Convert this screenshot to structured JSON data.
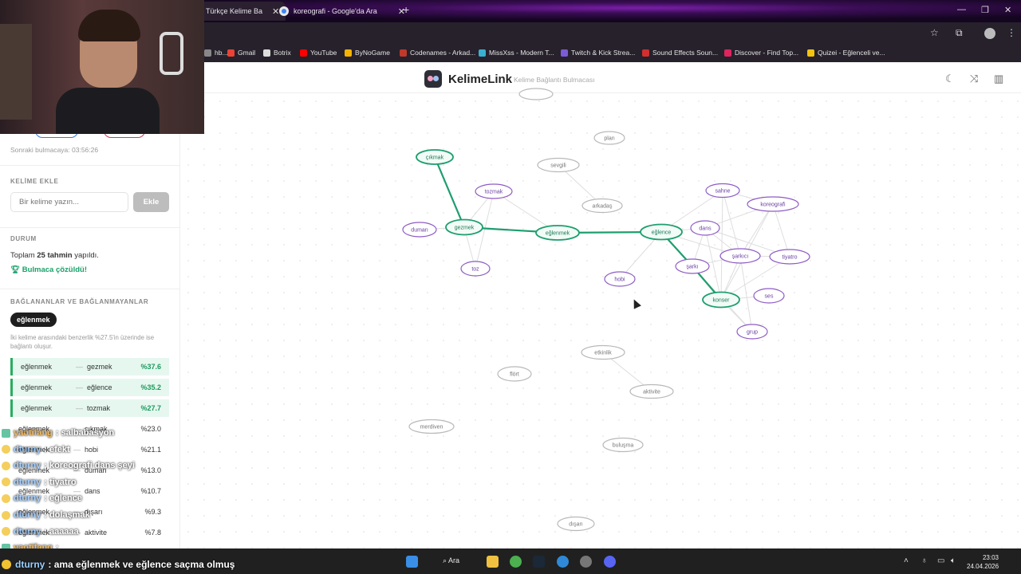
{
  "browser": {
    "tabs": [
      {
        "label": "Türkçe Kelime Ba",
        "active": true
      },
      {
        "label": "koreografi - Google'da Ara",
        "active": false
      }
    ],
    "bookmarks": [
      {
        "label": "hb...",
        "color": "#888888"
      },
      {
        "label": "Gmail",
        "color": "#ea4335"
      },
      {
        "label": "Botrix",
        "color": "#dddddd"
      },
      {
        "label": "YouTube",
        "color": "#ff0000"
      },
      {
        "label": "ByNoGame",
        "color": "#f5b400"
      },
      {
        "label": "Codenames - Arkad...",
        "color": "#c0392b"
      },
      {
        "label": "MissXss - Modern T...",
        "color": "#3ab0d0"
      },
      {
        "label": "Twitch & Kick Strea...",
        "color": "#7d5bd6"
      },
      {
        "label": "Sound Effects Soun...",
        "color": "#d32f2f"
      },
      {
        "label": "Discover - Find Top...",
        "color": "#e0245e"
      },
      {
        "label": "Quizei - Eğlenceli ve...",
        "color": "#f1c40f"
      }
    ]
  },
  "header": {
    "brand": "KelimeLink",
    "subtitle": "Kelime Bağlantı Bulmacası",
    "icons": [
      "moon-icon",
      "shuffle-icon",
      "stats-icon"
    ]
  },
  "sidebar": {
    "next_puzzle": "Sonraki bulmacaya: 03:56:26",
    "add_word_title": "KELİME EKLE",
    "input_placeholder": "Bir kelime yazın...",
    "add_button": "Ekle",
    "status_title": "DURUM",
    "total_prefix": "Toplam",
    "total_count": "25 tahmin",
    "total_suffix": "yapıldı.",
    "solved_text": "Bulmaca çözüldü!",
    "connections_title": "BAĞLANANLAR VE BAĞLANMAYANLAR",
    "selected_word": "eğlenmek",
    "hint": "İki kelime arasındaki benzerlik %27.5'in üzerinde ise bağlantı oluşur.",
    "rows": [
      {
        "a": "eğlenmek",
        "b": "gezmek",
        "pct": "%37.6",
        "connected": true
      },
      {
        "a": "eğlenmek",
        "b": "eğlence",
        "pct": "%35.2",
        "connected": true
      },
      {
        "a": "eğlenmek",
        "b": "tozmak",
        "pct": "%27.7",
        "connected": true
      },
      {
        "a": "eğlenmek",
        "b": "çıkmak",
        "pct": "%23.0",
        "connected": false
      },
      {
        "a": "eğlenmek",
        "b": "hobi",
        "pct": "%21.1",
        "connected": false
      },
      {
        "a": "eğlenmek",
        "b": "duman",
        "pct": "%13.0",
        "connected": false
      },
      {
        "a": "eğlenmek",
        "b": "dans",
        "pct": "%10.7",
        "connected": false
      },
      {
        "a": "eğlenmek",
        "b": "dışarı",
        "pct": "%9.3",
        "connected": false
      },
      {
        "a": "eğlenmek",
        "b": "aktivite",
        "pct": "%7.8",
        "connected": false
      }
    ]
  },
  "graph": {
    "colors": {
      "path": "#1e9e6e",
      "purple": "#8e5cc4",
      "grey": "#b9b9b9",
      "edge": "#dedede"
    },
    "nodes": [
      {
        "id": "top",
        "label": "",
        "kind": "grey"
      },
      {
        "id": "plan",
        "label": "plan",
        "kind": "grey"
      },
      {
        "id": "cikmak",
        "label": "çıkmak",
        "kind": "path"
      },
      {
        "id": "sevgili",
        "label": "sevgili",
        "kind": "grey"
      },
      {
        "id": "tozmak",
        "label": "tozmak",
        "kind": "purple"
      },
      {
        "id": "arkadas",
        "label": "arkadaş",
        "kind": "grey"
      },
      {
        "id": "sahne",
        "label": "sahne",
        "kind": "purple"
      },
      {
        "id": "koreografi",
        "label": "koreografi",
        "kind": "purple"
      },
      {
        "id": "duman",
        "label": "duman",
        "kind": "purple"
      },
      {
        "id": "gezmek",
        "label": "gezmek",
        "kind": "path"
      },
      {
        "id": "eglenmek",
        "label": "eğlenmek",
        "kind": "path"
      },
      {
        "id": "eglence",
        "label": "eğlence",
        "kind": "path"
      },
      {
        "id": "dans",
        "label": "dans",
        "kind": "purple"
      },
      {
        "id": "sarkici",
        "label": "şarkıcı",
        "kind": "purple"
      },
      {
        "id": "tiyatro",
        "label": "tiyatro",
        "kind": "purple"
      },
      {
        "id": "toz",
        "label": "toz",
        "kind": "purple"
      },
      {
        "id": "sarki",
        "label": "şarkı",
        "kind": "purple"
      },
      {
        "id": "hobi",
        "label": "hobi",
        "kind": "purple"
      },
      {
        "id": "ses",
        "label": "ses",
        "kind": "purple"
      },
      {
        "id": "konser",
        "label": "konser",
        "kind": "path"
      },
      {
        "id": "grup",
        "label": "grup",
        "kind": "purple"
      },
      {
        "id": "etkinlik",
        "label": "etkinlik",
        "kind": "grey"
      },
      {
        "id": "flort",
        "label": "flört",
        "kind": "grey"
      },
      {
        "id": "aktivite",
        "label": "aktivite",
        "kind": "grey"
      },
      {
        "id": "merdiven",
        "label": "merdiven",
        "kind": "grey"
      },
      {
        "id": "bulusma",
        "label": "buluşma",
        "kind": "grey"
      },
      {
        "id": "disari",
        "label": "dışarı",
        "kind": "grey"
      }
    ],
    "path_edges": [
      [
        "cikmak",
        "gezmek"
      ],
      [
        "gezmek",
        "eglenmek"
      ],
      [
        "eglenmek",
        "eglence"
      ],
      [
        "eglence",
        "sarki"
      ],
      [
        "sarki",
        "konser"
      ]
    ],
    "edges": [
      [
        "tozmak",
        "gezmek"
      ],
      [
        "tozmak",
        "eglenmek"
      ],
      [
        "tozmak",
        "toz"
      ],
      [
        "duman",
        "gezmek"
      ],
      [
        "gezmek",
        "toz"
      ],
      [
        "sevgili",
        "arkadas"
      ],
      [
        "eglence",
        "hobi"
      ],
      [
        "eglence",
        "dans"
      ],
      [
        "eglence",
        "sahne"
      ],
      [
        "sahne",
        "koreografi"
      ],
      [
        "sahne",
        "sarkici"
      ],
      [
        "sahne",
        "konser"
      ],
      [
        "koreografi",
        "dans"
      ],
      [
        "koreografi",
        "sarkici"
      ],
      [
        "koreografi",
        "tiyatro"
      ],
      [
        "koreografi",
        "konser"
      ],
      [
        "dans",
        "sarkici"
      ],
      [
        "dans",
        "konser"
      ],
      [
        "dans",
        "tiyatro"
      ],
      [
        "sarkici",
        "tiyatro"
      ],
      [
        "sarkici",
        "konser"
      ],
      [
        "sarkici",
        "sarki"
      ],
      [
        "sarkici",
        "grup"
      ],
      [
        "sarki",
        "grup"
      ],
      [
        "konser",
        "ses"
      ],
      [
        "konser",
        "grup"
      ],
      [
        "sarki",
        "dans"
      ],
      [
        "tiyatro",
        "konser"
      ],
      [
        "etkinlik",
        "aktivite"
      ],
      [
        "eglence",
        "sarkici"
      ]
    ]
  },
  "chat": [
    {
      "user": "yaotifang",
      "message": "salbabasyon",
      "badge": "g"
    },
    {
      "user": "dturny",
      "message": "efekt",
      "badge": "y"
    },
    {
      "user": "dturny",
      "message": "koreografi dans şeyi",
      "badge": "y"
    },
    {
      "user": "dturny",
      "message": "tiyatro",
      "badge": "y"
    },
    {
      "user": "dturny",
      "message": "eğlence",
      "badge": "y"
    },
    {
      "user": "dturny",
      "message": "dolaşmak",
      "badge": "y"
    },
    {
      "user": "dturny",
      "message": "aaaaaa",
      "badge": "y"
    },
    {
      "user": "yaotifang",
      "message": "",
      "badge": "g"
    }
  ],
  "bottom_chat": {
    "user": "dturny",
    "message": "ama eğlenmek ve eğlence saçma olmuş"
  },
  "taskbar": {
    "search": "Ara",
    "time": "23:03",
    "date": "24.04.2026"
  }
}
